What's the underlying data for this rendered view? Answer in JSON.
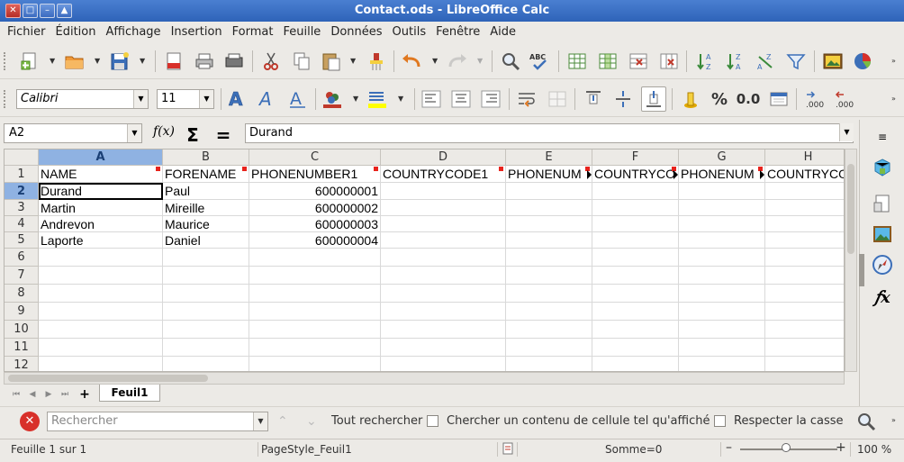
{
  "window": {
    "title": "Contact.ods - LibreOffice Calc",
    "controls": [
      "✕",
      "□",
      "–",
      "▲"
    ]
  },
  "menu": [
    "Fichier",
    "Édition",
    "Affichage",
    "Insertion",
    "Format",
    "Feuille",
    "Données",
    "Outils",
    "Fenêtre",
    "Aide"
  ],
  "toolbar": {
    "font_name": "Calibri",
    "font_size": "11",
    "percent_label": "%",
    "decimal_label": "0.0"
  },
  "formula_bar": {
    "cell_ref": "A2",
    "content": "Durand",
    "function_wizard": "f(x)",
    "sum_symbol": "Σ",
    "equals_symbol": "="
  },
  "sheet": {
    "columns": [
      "A",
      "B",
      "C",
      "D",
      "E",
      "F",
      "G",
      "H"
    ],
    "rows": [
      "1",
      "2",
      "3",
      "4",
      "5",
      "6",
      "7",
      "8",
      "9",
      "10",
      "11",
      "12"
    ],
    "selected_cell": "A2",
    "header_row": [
      "NAME",
      "FORENAME",
      "PHONENUMBER1",
      "COUNTRYCODE1",
      "PHONENUM",
      "COUNTRYCO",
      "PHONENUM",
      "COUNTRYCO"
    ],
    "data_rows": [
      [
        "Durand",
        "Paul",
        "600000001"
      ],
      [
        "Martin",
        "Mireille",
        "600000002"
      ],
      [
        "Andrevon",
        "Maurice",
        "600000003"
      ],
      [
        "Laporte",
        "Daniel",
        "600000004"
      ]
    ]
  },
  "tabs": {
    "add_label": "+",
    "sheets": [
      "Feuil1"
    ]
  },
  "find_toolbar": {
    "close_label": "✕",
    "search_placeholder": "Rechercher",
    "find_all": "Tout rechercher",
    "option_cell_content": "Chercher un contenu de cellule tel qu'affiché",
    "option_match_case": "Respecter la casse"
  },
  "status_bar": {
    "sheet_position": "Feuille 1 sur 1",
    "page_style": "PageStyle_Feuil1",
    "sum": "Somme=0",
    "zoom_minus": "–",
    "zoom_plus": "+",
    "zoom": "100 %",
    "zoom_level_percent": 100
  },
  "colors": {
    "titlebar": "#2e63b8",
    "selected_header": "#8fb2e2",
    "comment_marker": "#e8231c"
  }
}
